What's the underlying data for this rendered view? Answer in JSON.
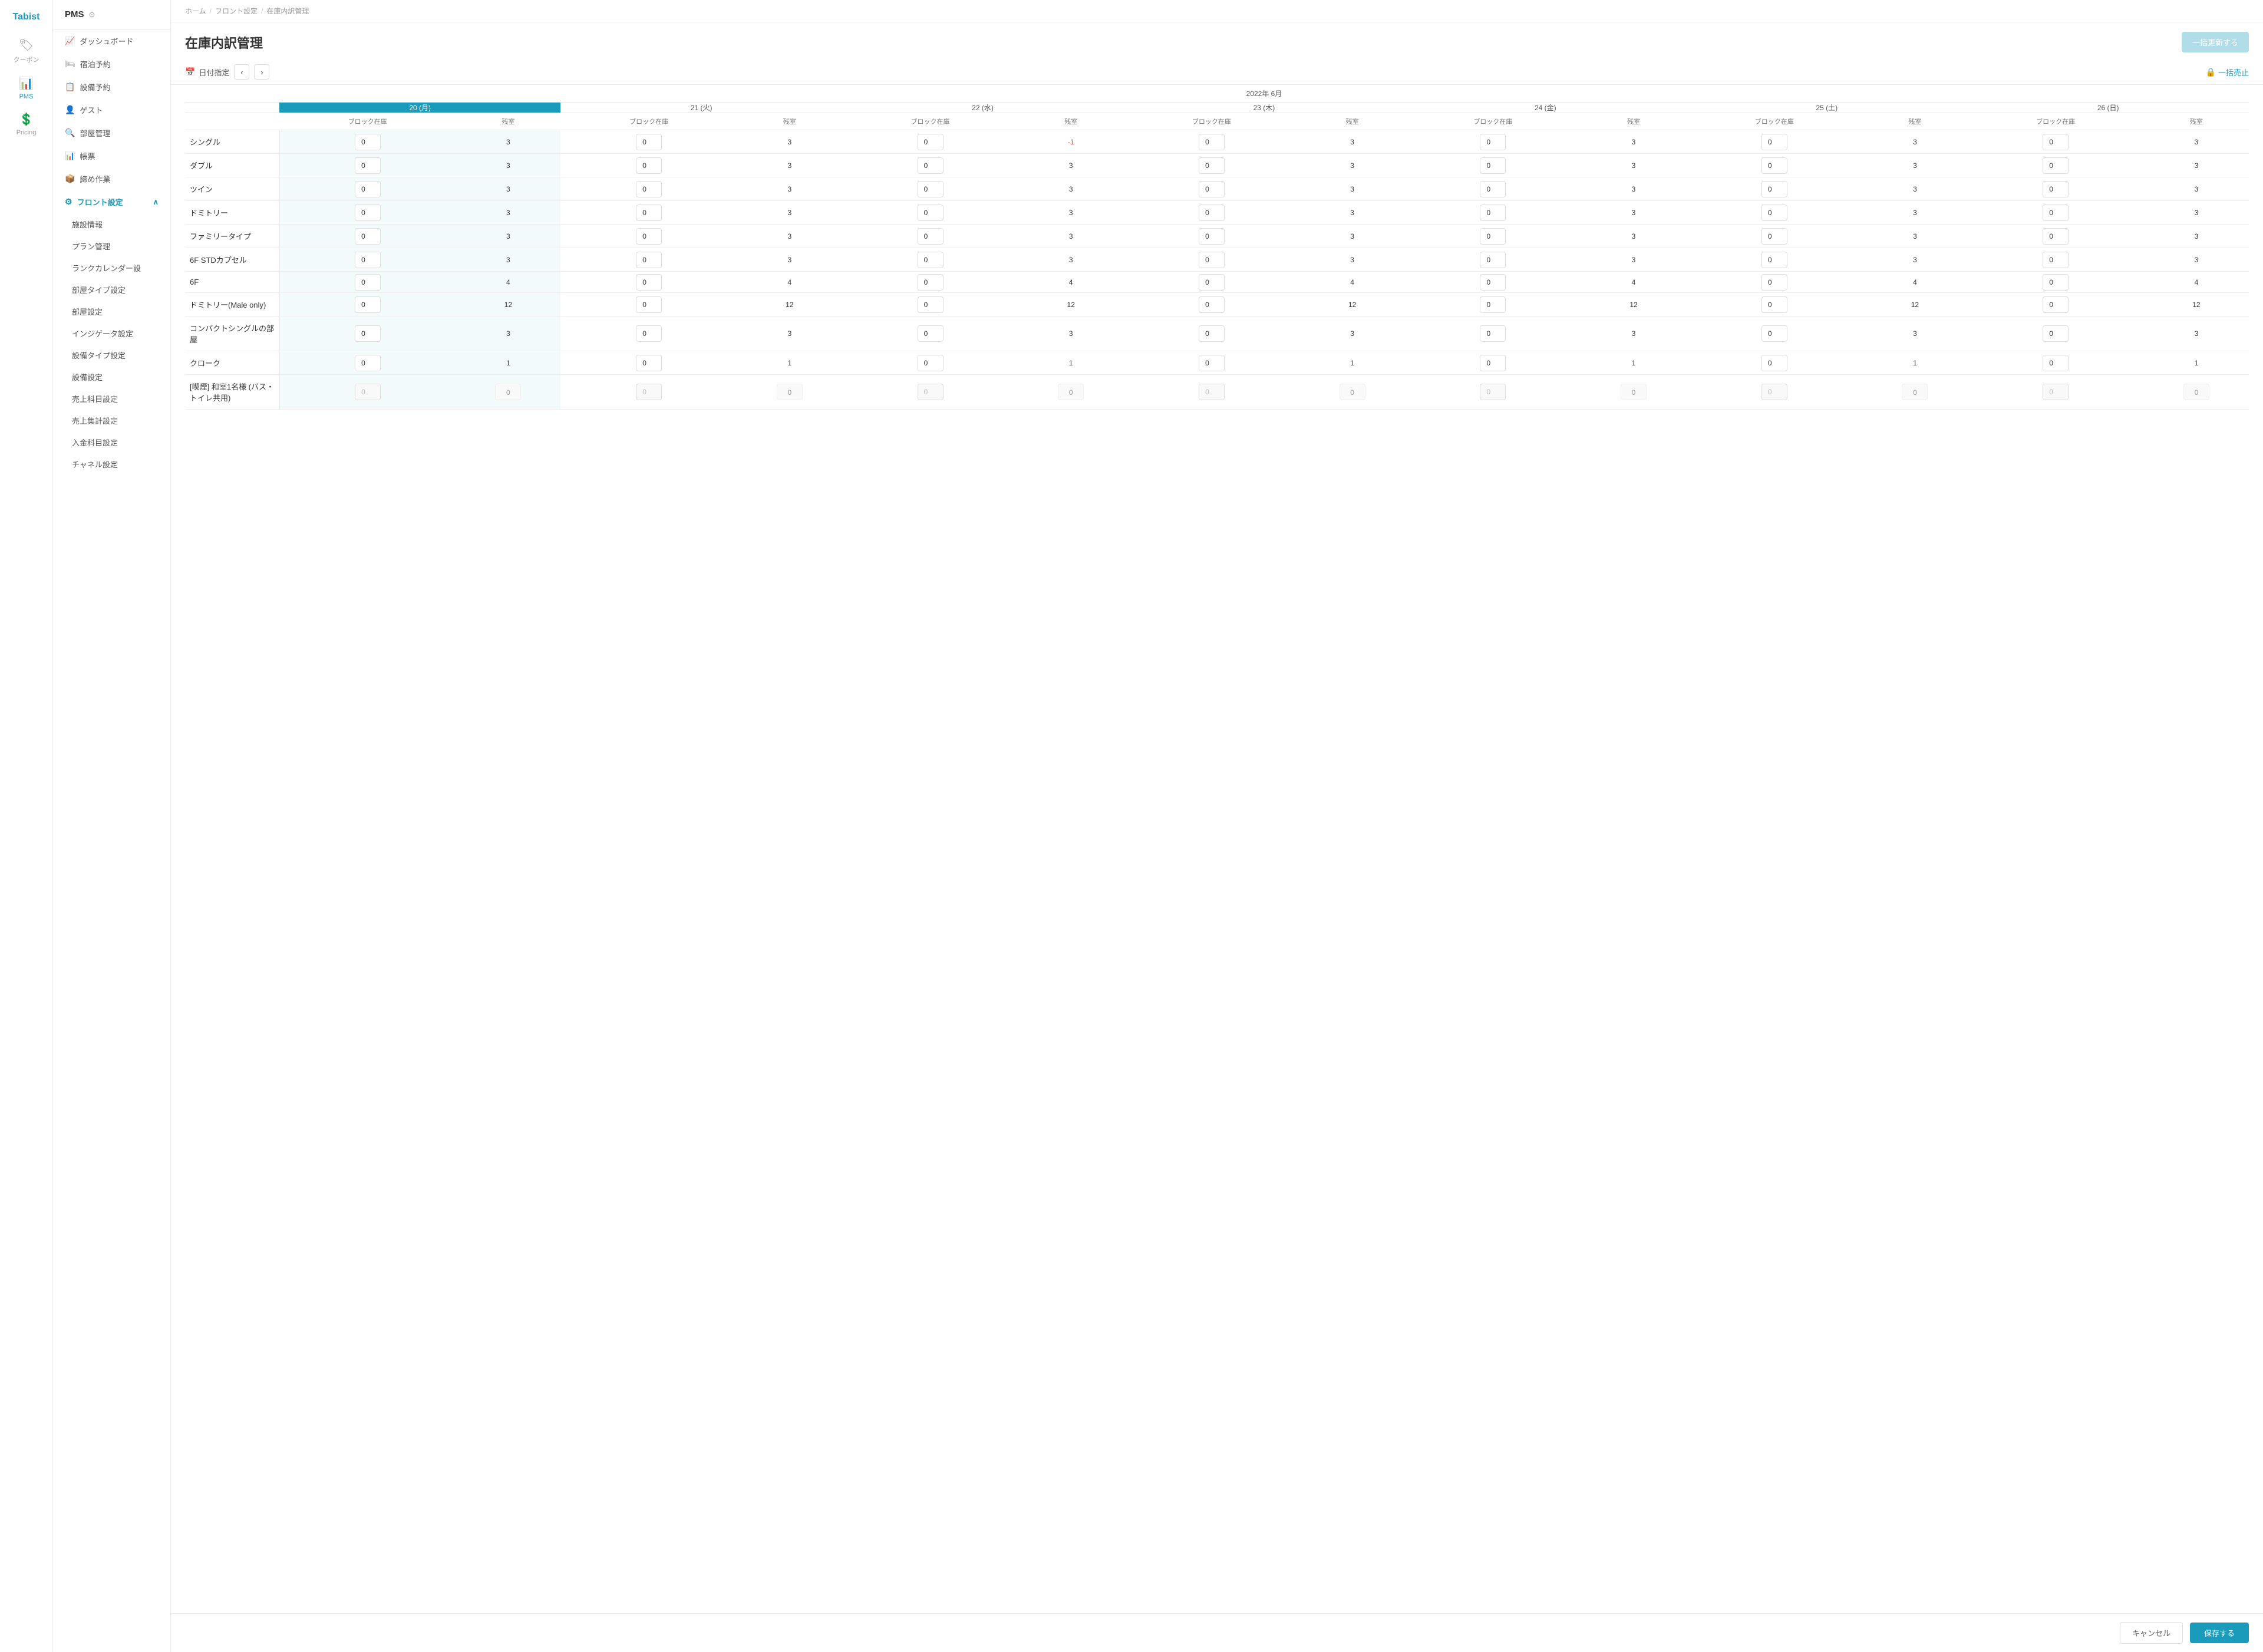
{
  "app": {
    "logo": "Tabist",
    "system_name": "PMS"
  },
  "sidebar": {
    "items": [
      {
        "id": "coupon",
        "label": "クーポン",
        "icon": "🏷",
        "active": false
      },
      {
        "id": "pms",
        "label": "PMS",
        "icon": "📊",
        "active": true
      },
      {
        "id": "pricing",
        "label": "Pricing",
        "icon": "💲",
        "active": false
      }
    ]
  },
  "left_nav": {
    "title": "PMS",
    "items": [
      {
        "id": "dashboard",
        "label": "ダッシュボード",
        "icon": "📈",
        "active": false
      },
      {
        "id": "lodging",
        "label": "宿泊予約",
        "icon": "🛏",
        "active": false
      },
      {
        "id": "facility",
        "label": "設備予約",
        "icon": "📋",
        "active": false
      },
      {
        "id": "guest",
        "label": "ゲスト",
        "icon": "👤",
        "active": false
      },
      {
        "id": "room_mgmt",
        "label": "部屋管理",
        "icon": "🔍",
        "active": false
      },
      {
        "id": "reports",
        "label": "帳票",
        "icon": "📊",
        "active": false
      },
      {
        "id": "closing",
        "label": "締め作業",
        "icon": "📦",
        "active": false
      },
      {
        "id": "front_settings",
        "label": "フロント設定",
        "icon": "⚙",
        "active": true,
        "expanded": true
      }
    ],
    "sub_items": [
      {
        "id": "facility_info",
        "label": "施設情報"
      },
      {
        "id": "plan_mgmt",
        "label": "プラン管理"
      },
      {
        "id": "rank_calendar",
        "label": "ランクカレンダー設"
      },
      {
        "id": "room_type_settings",
        "label": "部屋タイプ設定"
      },
      {
        "id": "room_settings",
        "label": "部屋設定"
      },
      {
        "id": "indigate_settings",
        "label": "インジゲータ設定"
      },
      {
        "id": "facility_type_settings",
        "label": "設備タイプ設定"
      },
      {
        "id": "facility_settings",
        "label": "設備設定"
      },
      {
        "id": "sales_account_settings",
        "label": "売上科目設定"
      },
      {
        "id": "sales_aggregate_settings",
        "label": "売上集計設定"
      },
      {
        "id": "income_account_settings",
        "label": "入金科目設定"
      },
      {
        "id": "channel_settings",
        "label": "チャネル設定"
      }
    ]
  },
  "breadcrumb": {
    "items": [
      {
        "label": "ホーム",
        "link": true
      },
      {
        "label": "フロント設定",
        "link": true
      },
      {
        "label": "在庫内訳管理",
        "link": false
      }
    ]
  },
  "page": {
    "title": "在庫内訳管理",
    "bulk_update_btn": "一括更新する",
    "date_label": "日付指定",
    "bulk_sell_btn": "一括売止",
    "month_label": "2022年 6月"
  },
  "calendar": {
    "days": [
      {
        "date": "20",
        "day": "月",
        "today": true
      },
      {
        "date": "21",
        "day": "火",
        "today": false
      },
      {
        "date": "22",
        "day": "水",
        "today": false
      },
      {
        "date": "23",
        "day": "木",
        "today": false
      },
      {
        "date": "24",
        "day": "金",
        "today": false
      },
      {
        "date": "25",
        "day": "土",
        "today": false
      },
      {
        "date": "26",
        "day": "日",
        "today": false
      }
    ],
    "col_headers": [
      "ブロック在庫",
      "残室"
    ]
  },
  "rooms": [
    {
      "name": "シングル",
      "days": [
        {
          "block": "0",
          "remaining": "3"
        },
        {
          "block": "0",
          "remaining": "3"
        },
        {
          "block": "0",
          "remaining": "-1",
          "negative": true
        },
        {
          "block": "0",
          "remaining": "3"
        },
        {
          "block": "0",
          "remaining": "3"
        },
        {
          "block": "0",
          "remaining": "3"
        },
        {
          "block": "0",
          "remaining": "3"
        }
      ]
    },
    {
      "name": "ダブル",
      "days": [
        {
          "block": "0",
          "remaining": "3"
        },
        {
          "block": "0",
          "remaining": "3"
        },
        {
          "block": "0",
          "remaining": "3"
        },
        {
          "block": "0",
          "remaining": "3"
        },
        {
          "block": "0",
          "remaining": "3"
        },
        {
          "block": "0",
          "remaining": "3"
        },
        {
          "block": "0",
          "remaining": "3"
        }
      ]
    },
    {
      "name": "ツイン",
      "days": [
        {
          "block": "0",
          "remaining": "3"
        },
        {
          "block": "0",
          "remaining": "3"
        },
        {
          "block": "0",
          "remaining": "3"
        },
        {
          "block": "0",
          "remaining": "3"
        },
        {
          "block": "0",
          "remaining": "3"
        },
        {
          "block": "0",
          "remaining": "3"
        },
        {
          "block": "0",
          "remaining": "3"
        }
      ]
    },
    {
      "name": "ドミトリー",
      "days": [
        {
          "block": "0",
          "remaining": "3"
        },
        {
          "block": "0",
          "remaining": "3"
        },
        {
          "block": "0",
          "remaining": "3"
        },
        {
          "block": "0",
          "remaining": "3"
        },
        {
          "block": "0",
          "remaining": "3"
        },
        {
          "block": "0",
          "remaining": "3"
        },
        {
          "block": "0",
          "remaining": "3"
        }
      ]
    },
    {
      "name": "ファミリータイプ",
      "days": [
        {
          "block": "0",
          "remaining": "3"
        },
        {
          "block": "0",
          "remaining": "3"
        },
        {
          "block": "0",
          "remaining": "3"
        },
        {
          "block": "0",
          "remaining": "3"
        },
        {
          "block": "0",
          "remaining": "3"
        },
        {
          "block": "0",
          "remaining": "3"
        },
        {
          "block": "0",
          "remaining": "3"
        }
      ]
    },
    {
      "name": "6F STDカプセル",
      "days": [
        {
          "block": "0",
          "remaining": "3"
        },
        {
          "block": "0",
          "remaining": "3"
        },
        {
          "block": "0",
          "remaining": "3"
        },
        {
          "block": "0",
          "remaining": "3"
        },
        {
          "block": "0",
          "remaining": "3"
        },
        {
          "block": "0",
          "remaining": "3"
        },
        {
          "block": "0",
          "remaining": "3"
        }
      ]
    },
    {
      "name": "6F",
      "days": [
        {
          "block": "0",
          "remaining": "4"
        },
        {
          "block": "0",
          "remaining": "4"
        },
        {
          "block": "0",
          "remaining": "4"
        },
        {
          "block": "0",
          "remaining": "4"
        },
        {
          "block": "0",
          "remaining": "4"
        },
        {
          "block": "0",
          "remaining": "4"
        },
        {
          "block": "0",
          "remaining": "4"
        }
      ]
    },
    {
      "name": "ドミトリー(Male only)",
      "days": [
        {
          "block": "0",
          "remaining": "12"
        },
        {
          "block": "0",
          "remaining": "12"
        },
        {
          "block": "0",
          "remaining": "12"
        },
        {
          "block": "0",
          "remaining": "12"
        },
        {
          "block": "0",
          "remaining": "12"
        },
        {
          "block": "0",
          "remaining": "12"
        },
        {
          "block": "0",
          "remaining": "12"
        }
      ]
    },
    {
      "name": "コンパクトシングルの部屋",
      "days": [
        {
          "block": "0",
          "remaining": "3"
        },
        {
          "block": "0",
          "remaining": "3"
        },
        {
          "block": "0",
          "remaining": "3"
        },
        {
          "block": "0",
          "remaining": "3"
        },
        {
          "block": "0",
          "remaining": "3"
        },
        {
          "block": "0",
          "remaining": "3"
        },
        {
          "block": "0",
          "remaining": "3"
        }
      ]
    },
    {
      "name": "クローク",
      "days": [
        {
          "block": "0",
          "remaining": "1"
        },
        {
          "block": "0",
          "remaining": "1"
        },
        {
          "block": "0",
          "remaining": "1"
        },
        {
          "block": "0",
          "remaining": "1"
        },
        {
          "block": "0",
          "remaining": "1"
        },
        {
          "block": "0",
          "remaining": "1"
        },
        {
          "block": "0",
          "remaining": "1"
        }
      ]
    },
    {
      "name": "[喫煙] 和室1名様 (バス・トイレ共用)",
      "days": [
        {
          "block": "0",
          "remaining": "0",
          "readonly": true
        },
        {
          "block": "0",
          "remaining": "0",
          "readonly": true
        },
        {
          "block": "0",
          "remaining": "0",
          "readonly": true
        },
        {
          "block": "0",
          "remaining": "0",
          "readonly": true
        },
        {
          "block": "0",
          "remaining": "0",
          "readonly": true
        },
        {
          "block": "0",
          "remaining": "0",
          "readonly": true
        },
        {
          "block": "0",
          "remaining": "0",
          "readonly": true
        }
      ]
    }
  ],
  "footer": {
    "cancel_label": "キャンセル",
    "save_label": "保存する"
  }
}
